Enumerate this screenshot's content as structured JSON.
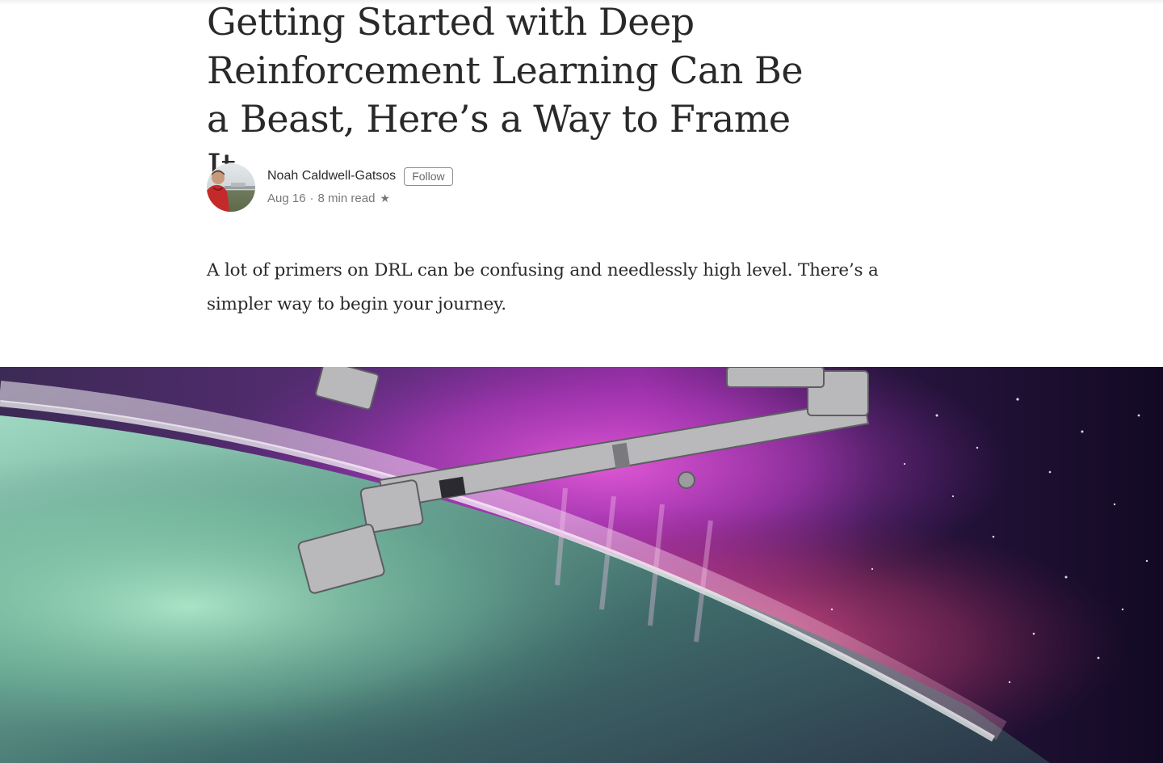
{
  "article": {
    "title": "Getting Started with Deep Reinforcement Learning Can Be a Beast, Here’s a Way to Frame It",
    "subtitle": "A lot of primers on DRL can be confusing and needlessly high level. There’s a simpler way to begin your journey."
  },
  "author": {
    "name": "Noah Caldwell-Gatsos",
    "follow_label": "Follow",
    "avatar_icon": "author-avatar-photo"
  },
  "meta": {
    "date": "Aug 16",
    "separator": "·",
    "read_time": "8 min read",
    "star": "★",
    "star_icon": "star-icon"
  },
  "hero": {
    "icon": "aurora-space-station-arm-photo",
    "colors": {
      "space": "#140b2a",
      "aurora_magenta": "#c13fc9",
      "aurora_pink": "#e0457f",
      "aurora_green": "#7fc9a2",
      "arm": "#b9b8bb"
    }
  }
}
